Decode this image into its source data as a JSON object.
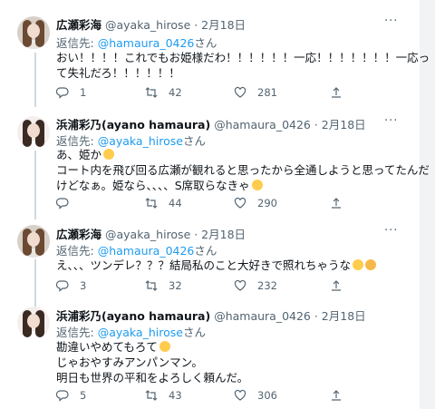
{
  "tweets": [
    {
      "name": "広瀬彩海",
      "handle": "@ayaka_hirose · 2月18日",
      "reply_prefix": "返信先: ",
      "reply_to": "@hamaura_0426",
      "reply_suffix": "さん",
      "lines": [
        "おい！！！！これでもお姫様だわ！！！！！！一応！！！！！！！一応っ",
        "て失礼だろ！！！！！！"
      ],
      "replies": "1",
      "retweets": "42",
      "likes": "281"
    },
    {
      "name": "浜浦彩乃(ayano hamaura)",
      "handle": "@hamaura_0426 · 2月18日",
      "reply_prefix": "返信先: ",
      "reply_to": "@ayaka_hirose",
      "reply_suffix": "さん",
      "lines": [
        "あ、姫か",
        "コート内を飛び回る広瀬が観れると思ったから全通しようと思ってたんだ",
        "けどなぁ。姫なら、、、、S席取らなきゃ"
      ],
      "replies": "",
      "retweets": "44",
      "likes": "290"
    },
    {
      "name": "広瀬彩海",
      "handle": "@ayaka_hirose · 2月18日",
      "reply_prefix": "返信先: ",
      "reply_to": "@hamaura_0426",
      "reply_suffix": "さん",
      "lines": [
        "え、、、ツンデレ？？？結局私のこと大好きで照れちゃうな"
      ],
      "replies": "3",
      "retweets": "32",
      "likes": "232"
    },
    {
      "name": "浜浦彩乃(ayano hamaura)",
      "handle": "@hamaura_0426 · 2月18日",
      "reply_prefix": "返信先: ",
      "reply_to": "@ayaka_hirose",
      "reply_suffix": "さん",
      "lines": [
        "勘違いやめてもろて",
        "じゃおやすみアンパンマン。",
        "明日も世界の平和をよろしく頼んだ。"
      ],
      "replies": "5",
      "retweets": "43",
      "likes": "306"
    }
  ],
  "more_label": "···"
}
